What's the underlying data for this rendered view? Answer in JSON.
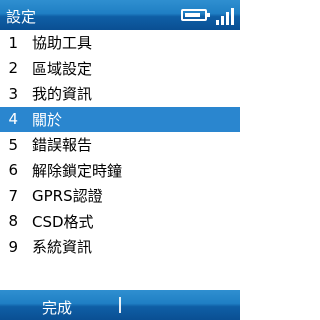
{
  "title": "設定",
  "status": {
    "battery_level": 0.85,
    "signal_level": 4
  },
  "items": [
    {
      "num": "1",
      "label": "協助工具"
    },
    {
      "num": "2",
      "label": "區域設定"
    },
    {
      "num": "3",
      "label": "我的資訊"
    },
    {
      "num": "4",
      "label": "關於"
    },
    {
      "num": "5",
      "label": "錯誤報告"
    },
    {
      "num": "6",
      "label": "解除鎖定時鐘"
    },
    {
      "num": "7",
      "label": "GPRS認證"
    },
    {
      "num": "8",
      "label": "CSD格式"
    },
    {
      "num": "9",
      "label": "系統資訊"
    }
  ],
  "selected_index": 3,
  "softkeys": {
    "left": "完成"
  }
}
